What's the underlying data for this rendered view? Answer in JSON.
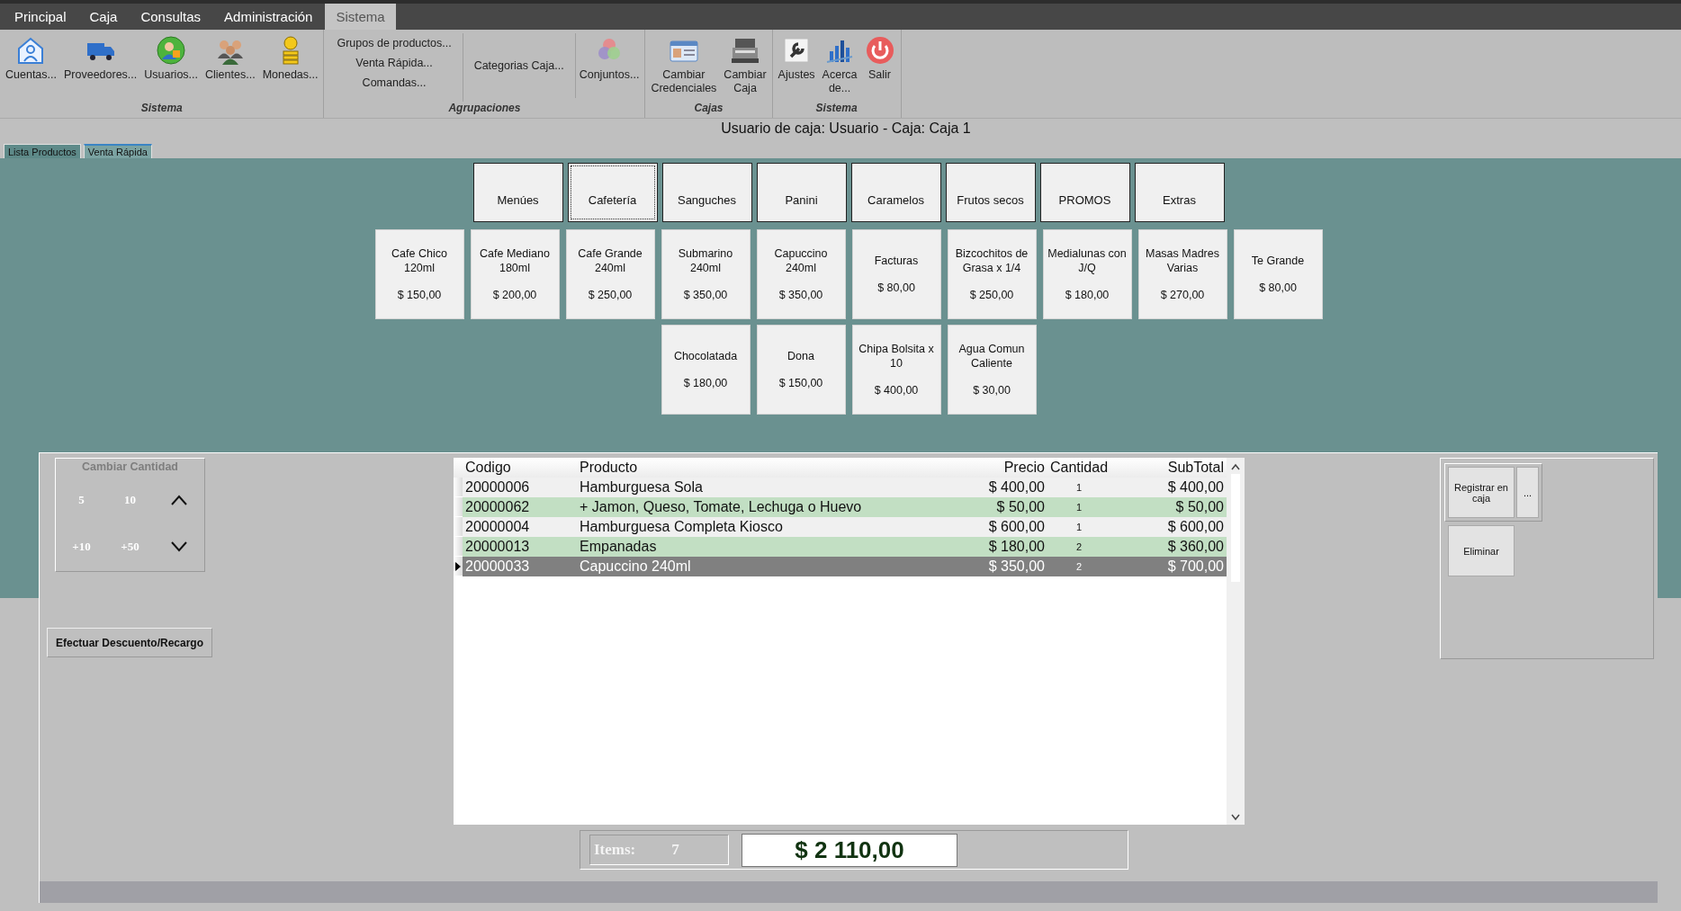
{
  "menu_tabs": [
    {
      "label": "Principal",
      "selected": false
    },
    {
      "label": "Caja",
      "selected": false
    },
    {
      "label": "Consultas",
      "selected": false
    },
    {
      "label": "Administración",
      "selected": false
    },
    {
      "label": "Sistema",
      "selected": true
    }
  ],
  "ribbon_groups": [
    {
      "title": "Sistema",
      "items": [
        {
          "kind": "large",
          "label": "Cuentas..."
        },
        {
          "kind": "large",
          "label": "Proveedores..."
        },
        {
          "kind": "large",
          "label": "Usuarios..."
        },
        {
          "kind": "large",
          "label": "Clientes..."
        },
        {
          "kind": "large",
          "label": "Monedas..."
        }
      ]
    },
    {
      "title": "Agrupaciones",
      "items": [
        {
          "kind": "stack",
          "labels": [
            "Grupos de productos...",
            "Venta Rápida...",
            "Comandas..."
          ]
        },
        {
          "kind": "small",
          "label": "Categorias Caja..."
        },
        {
          "kind": "large",
          "label": "Conjuntos..."
        }
      ]
    },
    {
      "title": "Cajas",
      "items": [
        {
          "kind": "large",
          "label": "Cambiar Credenciales"
        },
        {
          "kind": "large",
          "label": "Cambiar Caja"
        }
      ]
    },
    {
      "title": "Sistema",
      "items": [
        {
          "kind": "large",
          "label": "Ajustes"
        },
        {
          "kind": "large",
          "label": "Acerca de..."
        },
        {
          "kind": "large",
          "label": "Salir"
        }
      ]
    }
  ],
  "user_label": "Usuario de caja: Usuario - Caja: Caja 1",
  "view_tabs": [
    {
      "label": "Lista Productos",
      "selected": false
    },
    {
      "label": "Venta Rápida",
      "selected": true
    }
  ],
  "categories": [
    {
      "label": "Menúes",
      "selected": false
    },
    {
      "label": "Cafetería",
      "selected": true
    },
    {
      "label": "Sanguches",
      "selected": false
    },
    {
      "label": "Panini",
      "selected": false
    },
    {
      "label": "Caramelos",
      "selected": false
    },
    {
      "label": "Frutos secos",
      "selected": false
    },
    {
      "label": "PROMOS",
      "selected": false
    },
    {
      "label": "Extras",
      "selected": false
    }
  ],
  "products": [
    {
      "name": "Cafe Chico 120ml",
      "price": "$ 150,00"
    },
    {
      "name": "Cafe Mediano 180ml",
      "price": "$ 200,00"
    },
    {
      "name": "Cafe Grande 240ml",
      "price": "$ 250,00"
    },
    {
      "name": "Submarino 240ml",
      "price": "$ 350,00"
    },
    {
      "name": "Capuccino 240ml",
      "price": "$ 350,00"
    },
    {
      "name": "Facturas",
      "price": "$ 80,00"
    },
    {
      "name": "Bizcochitos de Grasa x 1/4",
      "price": "$ 250,00"
    },
    {
      "name": "Medialunas con J/Q",
      "price": "$ 180,00"
    },
    {
      "name": "Masas Madres Varias",
      "price": "$ 270,00"
    },
    {
      "name": "Te Grande",
      "price": "$ 80,00"
    },
    {
      "name": "Chocolatada",
      "price": "$ 180,00"
    },
    {
      "name": "Dona",
      "price": "$ 150,00"
    },
    {
      "name": "Chipa Bolsita x 10",
      "price": "$ 400,00"
    },
    {
      "name": "Agua Comun Caliente",
      "price": "$ 30,00"
    }
  ],
  "quantity_box": {
    "title": "Cambiar Cantidad",
    "disabled": true,
    "buttons": [
      "5",
      "10",
      "+10",
      "+50"
    ]
  },
  "discount_button": "Efectuar Descuento/Recargo",
  "table": {
    "columns": [
      "Codigo",
      "Producto",
      "Precio",
      "Cantidad",
      "SubTotal"
    ],
    "rows": [
      {
        "cells": [
          "20000006",
          "Hamburguesa Sola",
          "$ 400,00",
          "1",
          "$ 400,00"
        ],
        "selected": false
      },
      {
        "cells": [
          "20000062",
          "+ Jamon, Queso, Tomate, Lechuga o Huevo",
          "$ 50,00",
          "1",
          "$ 50,00"
        ],
        "selected": false
      },
      {
        "cells": [
          "20000004",
          "Hamburguesa Completa Kiosco",
          "$ 600,00",
          "1",
          "$ 600,00"
        ],
        "selected": false
      },
      {
        "cells": [
          "20000013",
          "Empanadas",
          "$ 180,00",
          "2",
          "$ 360,00"
        ],
        "selected": false
      },
      {
        "cells": [
          "20000033",
          "Capuccino 240ml",
          "$ 350,00",
          "2",
          "$ 700,00"
        ],
        "selected": true
      }
    ]
  },
  "actions": {
    "register": "Registrar en caja",
    "more": "...",
    "delete": "Eliminar"
  },
  "totals": {
    "items_label": "Items:",
    "items_count": "7",
    "total": "$ 2 110,00"
  }
}
